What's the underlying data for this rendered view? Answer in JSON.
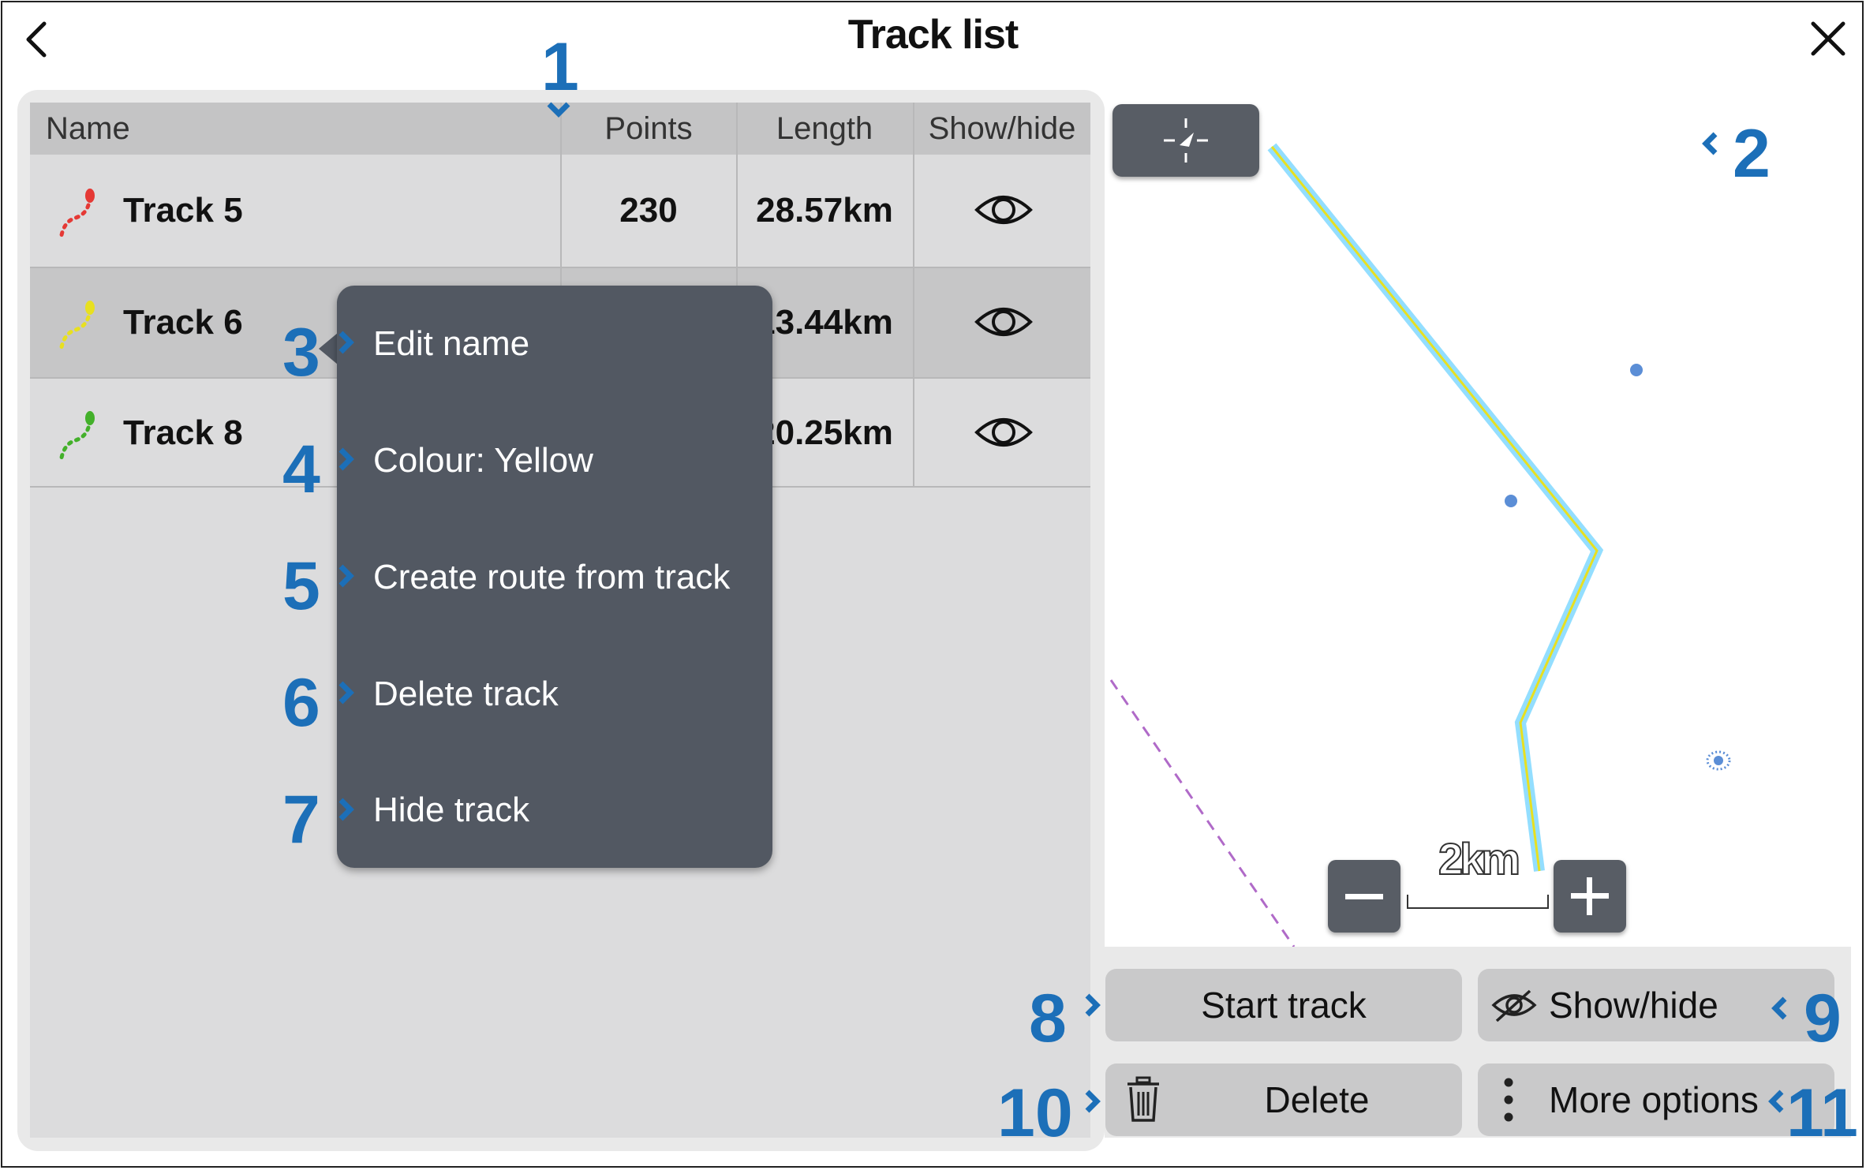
{
  "header": {
    "title": "Track list"
  },
  "table": {
    "columns": [
      "Name",
      "Points",
      "Length",
      "Show/hide"
    ],
    "rows": [
      {
        "name": "Track 5",
        "points": "230",
        "length": "28.57km",
        "color": "#e53935"
      },
      {
        "name": "Track 6",
        "points": "",
        "length": "13.44km",
        "color": "#e8e020"
      },
      {
        "name": "Track 8",
        "points": "",
        "length": "20.25km",
        "color": "#43b02a"
      }
    ]
  },
  "context_menu": {
    "items": [
      "Edit name",
      "Colour: Yellow",
      "Create route from track",
      "Delete track",
      "Hide track"
    ]
  },
  "map": {
    "scale_label": "2km"
  },
  "buttons": {
    "start_track": "Start track",
    "show_hide": "Show/hide",
    "delete": "Delete",
    "more_options": "More options"
  },
  "callouts": [
    "1",
    "2",
    "3",
    "4",
    "5",
    "6",
    "7",
    "8",
    "9",
    "10",
    "11"
  ],
  "colors": {
    "accent_callout": "#1c6fb8",
    "menu_bg": "#525862",
    "route": "#6fd3ff",
    "route_core": "#e8e020"
  }
}
